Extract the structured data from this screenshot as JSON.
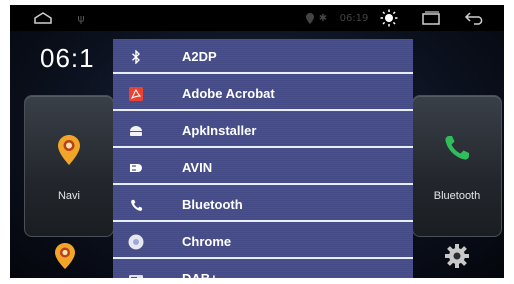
{
  "statusbar": {
    "time": "06:19"
  },
  "home": {
    "clock": "06:1"
  },
  "cards": {
    "left": {
      "label": "Navi"
    },
    "right": {
      "label": "Bluetooth"
    }
  },
  "menu": {
    "items": [
      {
        "label": "A2DP",
        "icon": "bluetooth-icon"
      },
      {
        "label": "Adobe Acrobat",
        "icon": "acrobat-icon"
      },
      {
        "label": "ApkInstaller",
        "icon": "apk-installer-icon"
      },
      {
        "label": "AVIN",
        "icon": "av-input-icon"
      },
      {
        "label": "Bluetooth",
        "icon": "phone-icon"
      },
      {
        "label": "Chrome",
        "icon": "chrome-icon"
      },
      {
        "label": "DAB+",
        "icon": "radio-icon"
      }
    ]
  },
  "colors": {
    "menu_bg": "#434a86",
    "navi_pin": "#f2a526",
    "phone_green": "#2fbf5a"
  }
}
